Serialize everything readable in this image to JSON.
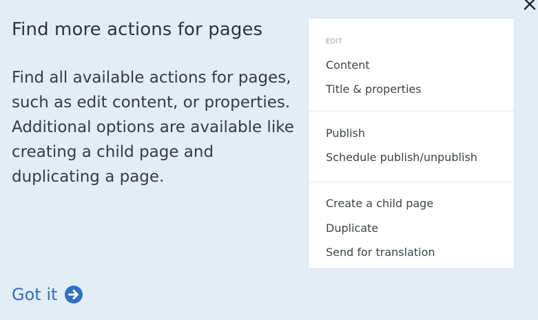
{
  "dialog": {
    "title": "Find more actions for pages",
    "description": "Find all available actions for pages, such as edit content, or properties. Additional options are available like creating a child page and duplicating a page.",
    "close_icon": "close-icon",
    "got_it_label": "Got it",
    "got_it_icon": "arrow-right-circle-icon",
    "accent_color": "#2f6fc6"
  },
  "menu": {
    "sections": [
      {
        "heading": "EDIT",
        "items": [
          "Content",
          "Title & properties"
        ]
      },
      {
        "heading": "",
        "items": [
          "Publish",
          "Schedule publish/unpublish"
        ]
      },
      {
        "heading": "",
        "items": [
          "Create a child page",
          "Duplicate",
          "Send for translation"
        ]
      }
    ]
  }
}
